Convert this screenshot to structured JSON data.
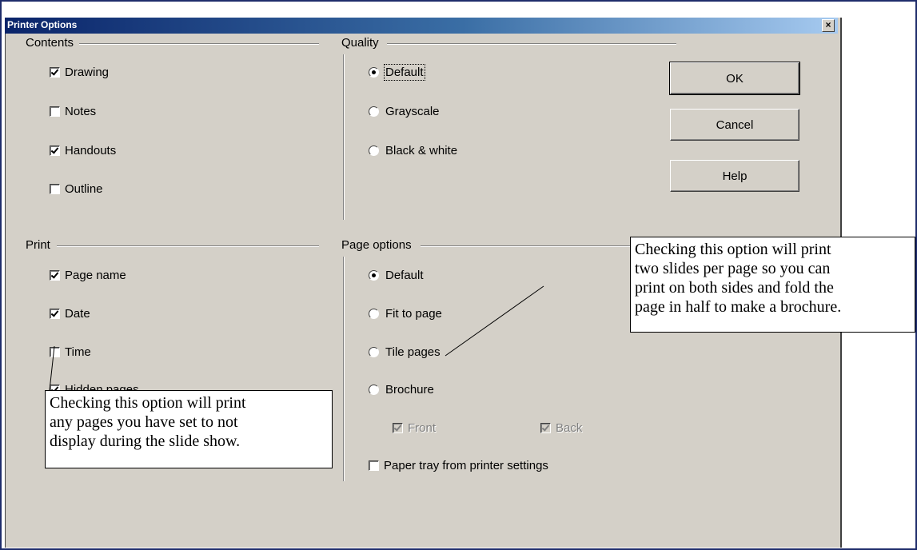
{
  "dialog": {
    "title": "Printer Options",
    "close_label": "x"
  },
  "contents": {
    "label": "Contents",
    "items": [
      {
        "label": "Drawing",
        "checked": true
      },
      {
        "label": "Notes",
        "checked": false
      },
      {
        "label": "Handouts",
        "checked": true
      },
      {
        "label": "Outline",
        "checked": false
      }
    ]
  },
  "quality": {
    "label": "Quality",
    "options": [
      {
        "label": "Default",
        "selected": true
      },
      {
        "label": "Grayscale",
        "selected": false
      },
      {
        "label": "Black & white",
        "selected": false
      }
    ]
  },
  "print": {
    "label": "Print",
    "items": [
      {
        "label": "Page name",
        "checked": true
      },
      {
        "label": "Date",
        "checked": true
      },
      {
        "label": "Time",
        "checked": false
      },
      {
        "label": "Hidden pages",
        "checked": true
      }
    ]
  },
  "page_options": {
    "label": "Page options",
    "options": [
      {
        "label": "Default",
        "selected": true
      },
      {
        "label": "Fit to page",
        "selected": false
      },
      {
        "label": "Tile pages",
        "selected": false
      },
      {
        "label": "Brochure",
        "selected": false
      }
    ],
    "front": {
      "label": "Front",
      "checked": true
    },
    "back": {
      "label": "Back",
      "checked": true
    },
    "paper_tray": {
      "label": "Paper tray from printer settings",
      "checked": false
    }
  },
  "buttons": {
    "ok": "OK",
    "cancel": "Cancel",
    "help": "Help"
  },
  "callouts": {
    "brochure": "Checking this option will print\ntwo slides per page so you can\nprint on both sides and fold the\npage in half to make a brochure.",
    "hidden": "Checking this option will print\nany pages you have set to not\ndisplay during the slide show."
  }
}
